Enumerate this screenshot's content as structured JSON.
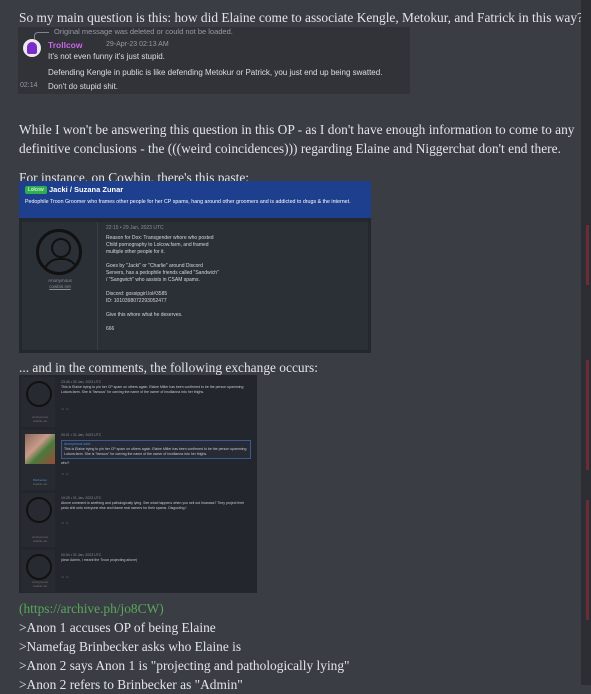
{
  "post": {
    "question": "So my main question is this: how did Elaine come to associate Kengle, Metokur, and Fatrick in this way?",
    "para1": [
      "While I won't be answering this question in this OP - as I don't have enough information to come to any",
      "definitive conclusions - the (((weird coincidences))) regarding Elaine and Niggerchat don't end there."
    ],
    "para2": "For instance, on Cowbin, there's this paste:",
    "para3": "... and in the comments, the following exchange occurs:",
    "archive_link": "(https://archive.ph/jo8CW)",
    "greentext": [
      ">Anon 1 accuses OP of being Elaine",
      ">Namefag Brinbecker asks who Elaine is",
      ">Anon 2 says Anon 1 is \"projecting and pathologically lying\"",
      ">Anon 2 refers to Brinbecker as \"Admin\""
    ]
  },
  "discord": {
    "reply_note": "Original message was deleted or could not be loaded.",
    "username": "Trollcow",
    "date": "29-Apr-23 02:13 AM",
    "messages": [
      "It's not even funny it's just stupid.",
      "Defending Kengle in public is like defending Metokur or Patrick, you just end up being swatted."
    ],
    "last_time": "02:14",
    "last_message": "Don't do stupid shit."
  },
  "paste": {
    "tag": "Lolcow",
    "title": "Jacki / Suzana Zunar",
    "description": "Pedophile Troon Groomer who frames other people for her CP spams, hang around other groomers and is addicted to drugs & the internet.",
    "author": "Anonymous",
    "author_sub": "cowbin.net",
    "timestamp": "22:15 • 29 Jan, 2023 UTC",
    "body": [
      "Reason for Dox: Transgender whore who posted",
      "Child pornography to Lolcow.farm, and framed",
      "multiple other people for it.",
      "",
      "Goes by \"Jacki\" or \"Charlie\" around Discord",
      "Servers, has a pedophile friends called \"Sandwich\"",
      "/ \"Sangwich\" who assists in CSAM spams.",
      "",
      "Discord: gossipgirl.lol#3585",
      "ID: 1010398072293052477",
      "",
      "Give this whore what he deserves.",
      "",
      "666"
    ]
  },
  "comments": [
    {
      "author": "Anonymous",
      "author_sub": "cowbin.net",
      "time": "23:46 • 30 Jan, 2023 UTC",
      "text": "This is Elaine trying to pin her CP spam on others again. Elaine Miller has been confirmed to be the person spamming Lolcow.farm. She is \"famous\" for carving the name of the owner of Imollianna into her thighs.",
      "reacts": "☺ ⚠"
    },
    {
      "author": "Brinbecker",
      "author_sub": "cowbin.net",
      "time": "00:21 • 31 Jan, 2023 UTC",
      "quote_head": "Anonymous said:",
      "quote": "This is Elaine trying to pin her CP spam on others again. Elaine Miller has been confirmed to be the person spamming Lolcow.farm. She is \"famous\" for carving the name of the owner of Imollianna into her thighs.",
      "text": "who?",
      "reacts": "☺ ⚠"
    },
    {
      "author": "Anonymous",
      "author_sub": "cowbin.net",
      "time": "19:25 • 31 Jan, 2023 UTC",
      "text": "Above comment is seething and pathologically lying. See what happens when you sell out Imanass? They project their pedo shit onto everyone else and blame real owners for their spams. Disgusting !",
      "reacts": "☺ ⚠"
    },
    {
      "author": "Anonymous",
      "author_sub": "cowbin.net",
      "time": "00:04 • 31 Jan, 2023 UTC",
      "text": "(dear Admin, I meant the Troon projecting above)",
      "reacts": "☺ ⚠"
    }
  ],
  "colors": {
    "background": "#3b3d45",
    "text": "#e3e4e8",
    "link": "#57a85a",
    "discord_username": "#c965e8",
    "paste_header": "#1d3f8e",
    "lolcow_tag": "#2fae4d"
  }
}
